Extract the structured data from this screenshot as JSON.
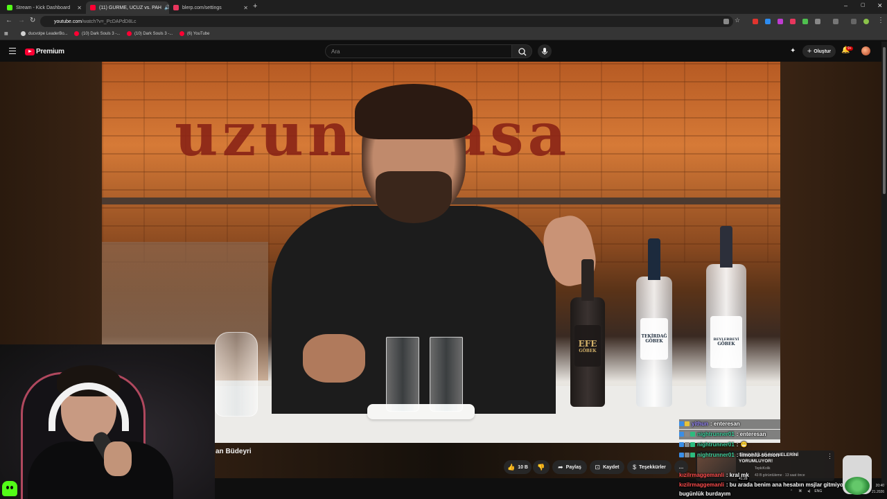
{
  "browser": {
    "tabs": [
      {
        "label": "Stream - Kick Dashboard",
        "color": "#53fc18",
        "active": false
      },
      {
        "label": "(11) GURME, UCUZ vs. PAH",
        "color": "#ff0033",
        "active": true
      },
      {
        "label": "blerp.com/settings",
        "color": "#e8365d",
        "active": false
      }
    ],
    "new_tab_glyph": "+",
    "window_controls": [
      "–",
      "▢",
      "✕"
    ],
    "url_host": "youtube.com",
    "url_path": "/watch?v=_PcDAPdD8Lc",
    "bookmarks": [
      {
        "label": "ducvolpe LeaderBo...",
        "color": "#d0d0d0"
      },
      {
        "label": "(10) Dark Souls 3 -...",
        "color": "#ff0033"
      },
      {
        "label": "(10) Dark Souls 3 -...",
        "color": "#ff0033"
      },
      {
        "label": "(6) YouTube",
        "color": "#ff0033"
      }
    ]
  },
  "youtube": {
    "logo_text": "Premium",
    "search_placeholder": "Ara",
    "create_label": "Oluştur",
    "notifications_badge": "9+",
    "video_sign_text": "uzun masa",
    "bottle_labels": [
      {
        "top": "EFE",
        "bottom": "GÖBEK"
      },
      {
        "top": "TEKİRDAĞ",
        "bottom": "GÖBEK"
      },
      {
        "top": "BEYLERBEYİ",
        "bottom": "GÖBEK"
      }
    ],
    "video_title_fragment": "an Büdeyri",
    "actions": {
      "like_count": "10 B",
      "share": "Paylaş",
      "save": "Kaydet",
      "thanks": "Teşekkürler",
      "more": "…"
    }
  },
  "notification": {
    "title": "SAVAŞ FİLMİ SAHNELERİNİ YORUMLUYOR!",
    "channel": "TepkiKolik",
    "meta": "43 B görüntüleme · 13 saat önce",
    "duration": "41:28"
  },
  "chat": [
    {
      "user": "yithun",
      "msg": ": enteresan",
      "color": "#9b8cff"
    },
    {
      "user": "nightrunner01",
      "msg": ": enteresan",
      "color": "#3fd3a0"
    },
    {
      "user": "nightrunner01",
      "msg": ":",
      "color": "#3fd3a0"
    },
    {
      "user": "nightrunner01",
      "msg": ": limonlu somon",
      "color": "#3fd3a0"
    },
    {
      "user": "kızilrmaggemanli",
      "msg": ": kral mk",
      "color": "#ff4d4d"
    },
    {
      "user": "kızilrmaggemanli",
      "msg": ": bu arada benim ana hesabın msjlar gitmiyo",
      "color": "#ff4d4d"
    },
    {
      "user": "",
      "msg": "bugünlük burdayım",
      "color": "#ffffff"
    }
  ],
  "taskbar": {
    "lang": "ENG",
    "time": "20:40",
    "date": "21.2026"
  },
  "colors": {
    "yt_red": "#ff0033",
    "kick_green": "#53fc18"
  }
}
